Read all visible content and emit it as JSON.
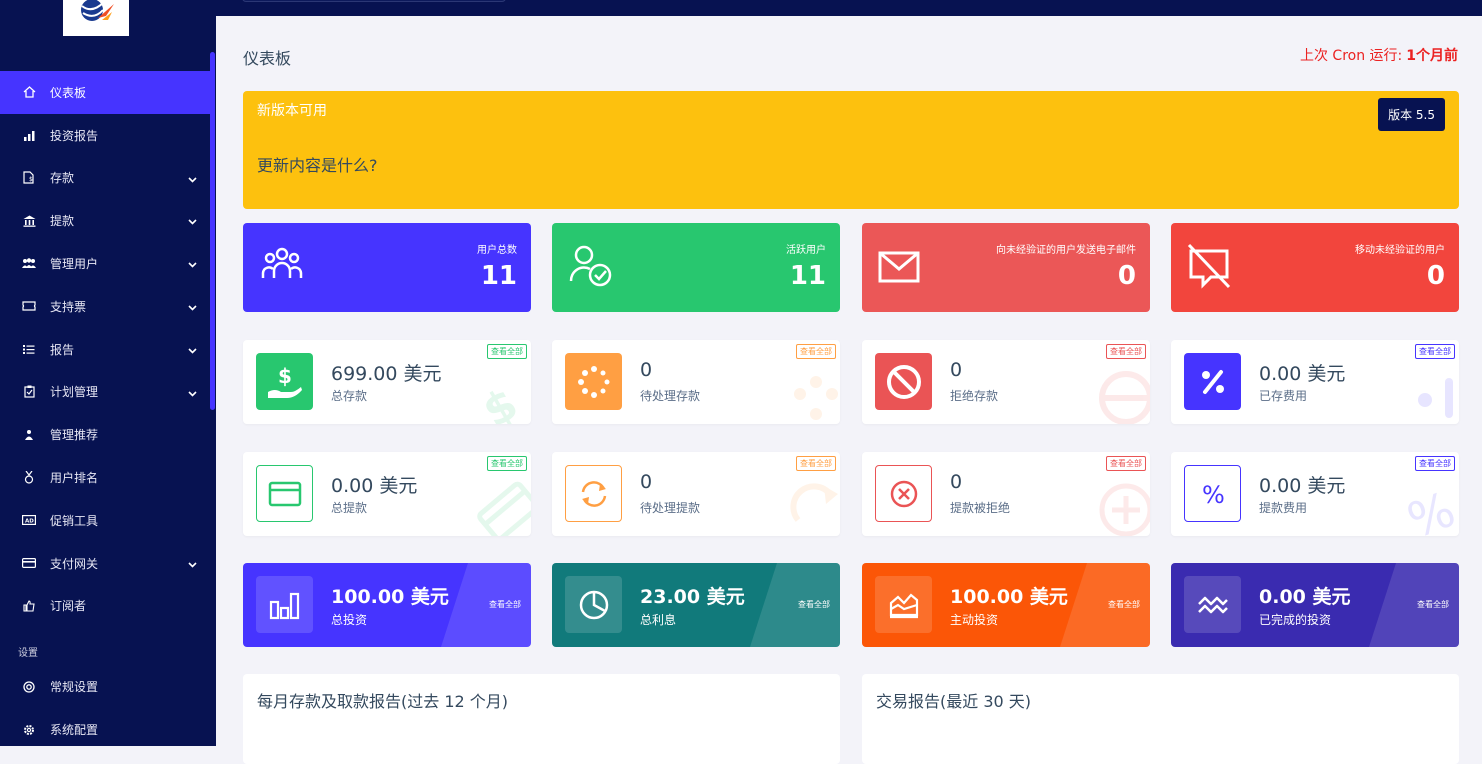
{
  "sidebar": {
    "items": [
      {
        "label": "仪表板",
        "icon": "home-icon",
        "active": true,
        "chevron": false
      },
      {
        "label": "投资报告",
        "icon": "bar-chart-icon",
        "chevron": false
      },
      {
        "label": "存款",
        "icon": "deposit-icon",
        "chevron": true
      },
      {
        "label": "提款",
        "icon": "bank-icon",
        "chevron": true
      },
      {
        "label": "管理用户",
        "icon": "users-icon",
        "chevron": true
      },
      {
        "label": "支持票",
        "icon": "ticket-icon",
        "chevron": true
      },
      {
        "label": "报告",
        "icon": "list-icon",
        "chevron": true
      },
      {
        "label": "计划管理",
        "icon": "clipboard-icon",
        "chevron": true
      },
      {
        "label": "管理推荐",
        "icon": "referral-icon",
        "chevron": false
      },
      {
        "label": "用户排名",
        "icon": "medal-icon",
        "chevron": false
      },
      {
        "label": "促销工具",
        "icon": "ad-icon",
        "chevron": false
      },
      {
        "label": "支付网关",
        "icon": "credit-card-icon",
        "chevron": true
      },
      {
        "label": "订阅者",
        "icon": "thumbs-up-icon",
        "chevron": false
      }
    ],
    "section_label": "设置",
    "settings_items": [
      {
        "label": "常规设置",
        "icon": "life-ring-icon"
      },
      {
        "label": "系统配置",
        "icon": "cog-icon"
      }
    ]
  },
  "header": {
    "title": "仪表板",
    "cron_label": "上次 Cron 运行:",
    "cron_value": "1个月前"
  },
  "banner": {
    "title": "新版本可用",
    "whats_new": "更新内容是什么?",
    "version": "版本 5.5",
    "color": "#fdc10e"
  },
  "stats_row1": [
    {
      "label": "用户总数",
      "value": "11",
      "color": "#4634ff",
      "icon": "users-group-icon"
    },
    {
      "label": "活跃用户",
      "value": "11",
      "color": "#28c76f",
      "icon": "user-check-icon"
    },
    {
      "label": "向未经验证的用户发送电子邮件",
      "value": "0",
      "color": "#eb5757",
      "icon": "envelope-icon"
    },
    {
      "label": "移动未经验证的用户",
      "value": "0",
      "color": "#f2453d",
      "icon": "comment-slash-icon"
    }
  ],
  "deposits": [
    {
      "value": "699.00 美元",
      "label": "总存款",
      "view_all": "查看全部",
      "color": "#28c76f",
      "icon": "hand-dollar-icon"
    },
    {
      "value": "0",
      "label": "待处理存款",
      "view_all": "查看全部",
      "color": "#ff9f43",
      "icon": "spinner-icon"
    },
    {
      "value": "0",
      "label": "拒绝存款",
      "view_all": "查看全部",
      "color": "#ea5455",
      "icon": "ban-icon"
    },
    {
      "value": "0.00 美元",
      "label": "已存费用",
      "view_all": "查看全部",
      "color": "#4634ff",
      "icon": "percentage-icon"
    }
  ],
  "withdrawals": [
    {
      "value": "0.00 美元",
      "label": "总提款",
      "view_all": "查看全部",
      "color": "#28c76f",
      "icon": "card-icon"
    },
    {
      "value": "0",
      "label": "待处理提款",
      "view_all": "查看全部",
      "color": "#ff9f43",
      "icon": "sync-icon"
    },
    {
      "value": "0",
      "label": "提款被拒绝",
      "view_all": "查看全部",
      "color": "#ea5455",
      "icon": "times-circle-icon"
    },
    {
      "value": "0.00 美元",
      "label": "提款费用",
      "view_all": "查看全部",
      "color": "#4634ff",
      "icon": "percent-icon"
    }
  ],
  "investments": [
    {
      "value": "100.00 美元",
      "label": "总投资",
      "view_all": "查看全部",
      "color": "#4634ff",
      "icon": "chart-bars-icon"
    },
    {
      "value": "23.00 美元",
      "label": "总利息",
      "view_all": "查看全部",
      "color": "#117a7b",
      "icon": "pie-chart-icon"
    },
    {
      "value": "100.00 美元",
      "label": "主动投资",
      "view_all": "查看全部",
      "color": "#fb5607",
      "icon": "chart-area-icon"
    },
    {
      "value": "0.00 美元",
      "label": "已完成的投资",
      "view_all": "查看全部",
      "color": "#3a2bb0",
      "icon": "wave-icon"
    }
  ],
  "reports": {
    "monthly_title": "每月存款及取款报告(过去 12 个月)",
    "transactions_title": "交易报告(最近 30 天)"
  }
}
